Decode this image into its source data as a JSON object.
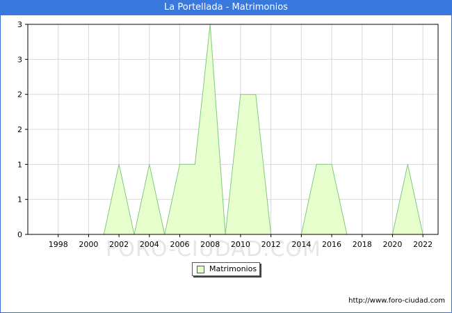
{
  "title": "La Portellada - Matrimonios",
  "watermark": "FORO-CIUDAD.COM",
  "source_url": "http://www.foro-ciudad.com",
  "colors": {
    "fill": "#e6ffcc",
    "line": "#7fc97f",
    "title_bg": "#3a78dd",
    "grid": "#d8d8d8"
  },
  "chart_data": {
    "type": "area",
    "title": "La Portellada - Matrimonios",
    "x": [
      1996,
      1997,
      1998,
      1999,
      2000,
      2001,
      2002,
      2003,
      2004,
      2005,
      2006,
      2007,
      2008,
      2009,
      2010,
      2011,
      2012,
      2013,
      2014,
      2015,
      2016,
      2017,
      2018,
      2019,
      2020,
      2021,
      2022
    ],
    "series": [
      {
        "name": "Matrimonios",
        "values": [
          0,
          0,
          0,
          0,
          0,
          0,
          1,
          0,
          1,
          0,
          1,
          1,
          3,
          0,
          2,
          2,
          0,
          0,
          0,
          1,
          1,
          0,
          0,
          0,
          0,
          1,
          0
        ]
      }
    ],
    "xlim": [
      1996,
      2023
    ],
    "ylim": [
      0,
      3
    ],
    "x_tick_labels": [
      "1998",
      "2000",
      "2002",
      "2004",
      "2006",
      "2008",
      "2010",
      "2012",
      "2014",
      "2016",
      "2018",
      "2020",
      "2022"
    ],
    "y_tick_labels": [
      "0",
      "1",
      "1",
      "2",
      "2",
      "3",
      "3"
    ],
    "xlabel": "",
    "ylabel": "",
    "grid": true,
    "legend_position": "bottom-center"
  }
}
